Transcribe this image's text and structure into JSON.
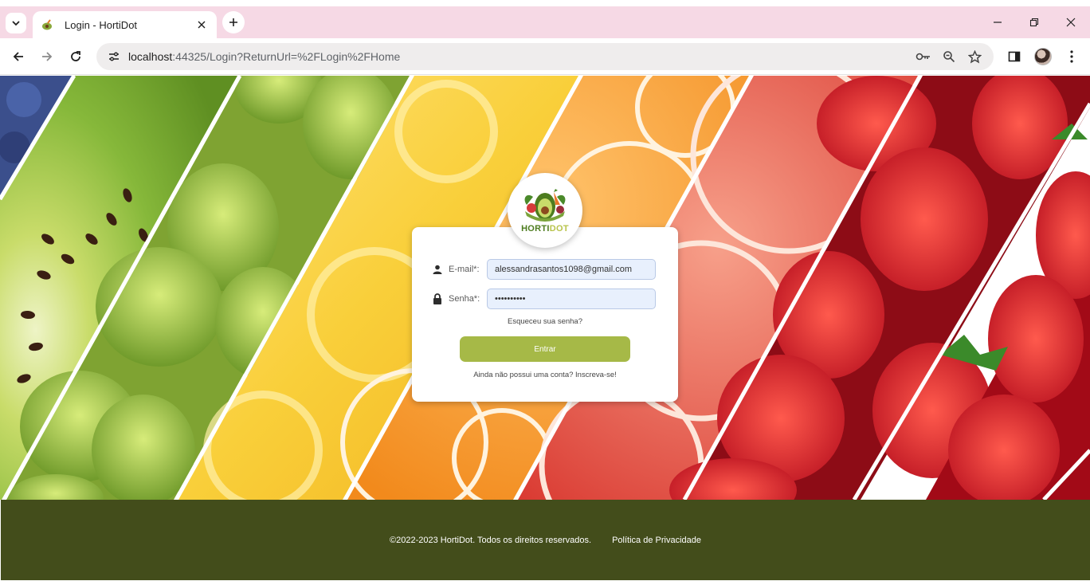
{
  "browser": {
    "tab_title": "Login - HortiDot",
    "url_host": "localhost",
    "url_rest": ":44325/Login?ReturnUrl=%2FLogin%2FHome",
    "icons": [
      "tab-search-icon",
      "close-icon",
      "plus-icon",
      "minimize-icon",
      "restore-icon",
      "close-window-icon",
      "back-icon",
      "forward-icon",
      "reload-icon",
      "site-info-icon",
      "key-icon",
      "zoom-icon",
      "star-icon",
      "side-panel-icon",
      "avatar",
      "more-icon"
    ]
  },
  "brand": {
    "name_part1": "HORTI",
    "name_part2": "DOT",
    "primary_color": "#4d7c1f",
    "accent_color": "#a6b947",
    "footer_color": "#434d1b"
  },
  "login": {
    "email_label": "E-mail*:",
    "email_value": "alessandrasantos1098@gmail.com",
    "password_label": "Senha*:",
    "password_value": "••••••••••",
    "forgot_link": "Esqueceu sua senha?",
    "submit_label": "Entrar",
    "signup_link": "Ainda não possui uma conta? Inscreva-se!"
  },
  "footer": {
    "copyright": "©2022-2023 HortiDot. Todos os direitos reservados.",
    "privacy_link": "Política de Privacidade"
  }
}
